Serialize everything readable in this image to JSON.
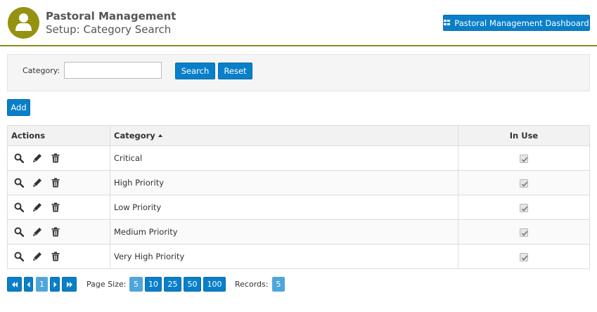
{
  "header": {
    "title": "Pastoral Management",
    "subtitle": "Setup: Category Search",
    "dashboard_button": "Pastoral Management Dashboard",
    "brand_color": "#959211",
    "accent_color": "#0a7fc9"
  },
  "search": {
    "label": "Category:",
    "value": "",
    "search_button": "Search",
    "reset_button": "Reset"
  },
  "add_button": "Add",
  "table": {
    "columns": [
      "Actions",
      "Category",
      "In Use"
    ],
    "sorted_column": "Category",
    "sort_direction": "ascending",
    "rows": [
      {
        "category": "Critical",
        "in_use": true
      },
      {
        "category": "High Priority",
        "in_use": true
      },
      {
        "category": "Low Priority",
        "in_use": true
      },
      {
        "category": "Medium Priority",
        "in_use": true
      },
      {
        "category": "Very High Priority",
        "in_use": true
      }
    ],
    "row_icons": [
      "search-icon",
      "pencil-icon",
      "trash-icon"
    ]
  },
  "pager": {
    "first_icon": "double-left-icon",
    "prev_icon": "left-icon",
    "current_page": "1",
    "next_icon": "right-icon",
    "last_icon": "double-right-icon",
    "page_size_label": "Page Size:",
    "page_sizes": [
      "5",
      "10",
      "25",
      "50",
      "100"
    ],
    "selected_page_size": "5",
    "records_label": "Records:",
    "records_count": "5"
  }
}
